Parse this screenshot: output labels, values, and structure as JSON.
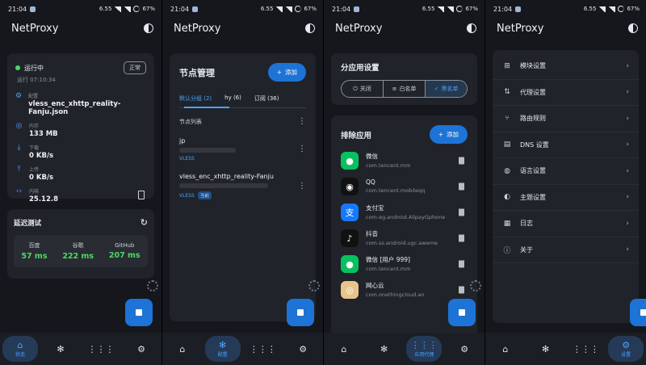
{
  "status_bar": {
    "time": "21:04",
    "battery": "67%",
    "net1": "6.55",
    "net2": "4G"
  },
  "app_title": "NetProxy",
  "screen1": {
    "running_label": "运行中",
    "normal_button": "正常",
    "uptime": "运行 07:10:34",
    "info": [
      {
        "icon": "gear-icon",
        "label": "配置",
        "value": "vless_enc_xhttp_reality-Fanju.json"
      },
      {
        "icon": "memory-icon",
        "label": "内存",
        "value": "133 MB"
      },
      {
        "icon": "download-icon",
        "label": "下载",
        "value": "0 KB/s"
      },
      {
        "icon": "upload-icon",
        "label": "上传",
        "value": "0 KB/s"
      },
      {
        "icon": "code-icon",
        "label": "内核",
        "value": "25.12.8"
      }
    ],
    "latency": {
      "title": "延迟测试",
      "items": [
        {
          "name": "百度",
          "value": "57 ms"
        },
        {
          "name": "谷歌",
          "value": "222 ms"
        },
        {
          "name": "GitHub",
          "value": "207 ms"
        }
      ]
    }
  },
  "screen2": {
    "title": "节点管理",
    "add_button": "添加",
    "tabs": [
      "默认分组 (2)",
      "hy (6)",
      "订阅 (36)"
    ],
    "list_title": "节点列表",
    "nodes": [
      {
        "name": "jp",
        "protocol": "VLESS",
        "badge": ""
      },
      {
        "name": "vless_enc_xhttp_reality-Fanju",
        "protocol": "VLESS",
        "badge": "当前"
      }
    ]
  },
  "screen3": {
    "split_title": "分应用设置",
    "modes": [
      "关闭",
      "白名单",
      "黑名单"
    ],
    "apps_title": "排除应用",
    "add_button": "添加",
    "apps": [
      {
        "name": "微信",
        "pkg": "com.tencent.mm",
        "color": "#07c160",
        "glyph": "●"
      },
      {
        "name": "QQ",
        "pkg": "com.tencent.mobileqq",
        "color": "#111111",
        "glyph": "◉"
      },
      {
        "name": "支付宝",
        "pkg": "com.eg.android.AlipayGphone",
        "color": "#1677ff",
        "glyph": "支"
      },
      {
        "name": "抖音",
        "pkg": "com.ss.android.ugc.aweme",
        "color": "#111111",
        "glyph": "♪"
      },
      {
        "name": "微信 [用户 999]",
        "pkg": "com.tencent.mm",
        "color": "#07c160",
        "glyph": "●"
      },
      {
        "name": "网心云",
        "pkg": "com.onethingcloud.an",
        "color": "#e8c48a",
        "glyph": "◎"
      }
    ]
  },
  "screen4": {
    "menu": [
      {
        "icon": "module-icon",
        "glyph": "⊞",
        "label": "模块设置"
      },
      {
        "icon": "proxy-icon",
        "glyph": "⇅",
        "label": "代理设置"
      },
      {
        "icon": "route-icon",
        "glyph": "⑂",
        "label": "路由规则"
      },
      {
        "icon": "dns-icon",
        "glyph": "▤",
        "label": "DNS 设置"
      },
      {
        "icon": "globe-icon",
        "glyph": "◍",
        "label": "语言设置"
      },
      {
        "icon": "palette-icon",
        "glyph": "◐",
        "label": "主题设置"
      },
      {
        "icon": "log-icon",
        "glyph": "▦",
        "label": "日志"
      },
      {
        "icon": "info-icon",
        "glyph": "ⓘ",
        "label": "关于"
      }
    ]
  },
  "nav": {
    "status_label": "状态",
    "config_label": "配置",
    "apps_label": "应用代理",
    "settings_label": "设置"
  },
  "colors": {
    "accent": "#1d73d6",
    "link": "#4aa3ff",
    "success": "#4cd964",
    "card": "#202329",
    "background": "#15171c"
  }
}
